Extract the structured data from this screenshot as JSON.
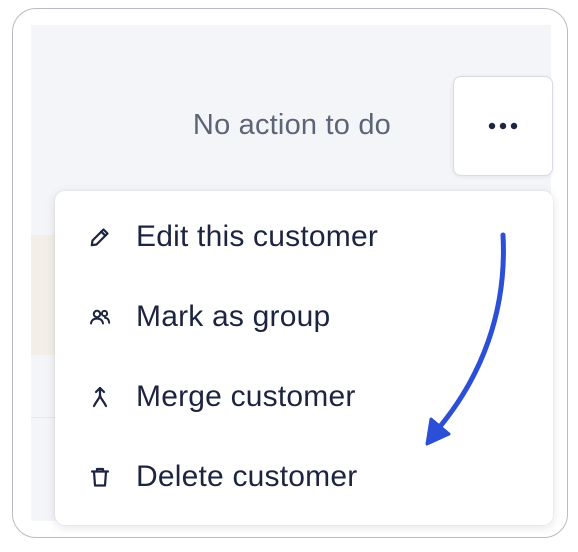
{
  "status": {
    "text": "No action to do"
  },
  "more_button": {
    "icon": "more-horizontal-icon"
  },
  "menu": {
    "items": [
      {
        "label": "Edit this customer",
        "icon": "pencil-icon"
      },
      {
        "label": "Mark as group",
        "icon": "users-icon"
      },
      {
        "label": "Merge customer",
        "icon": "merge-icon"
      },
      {
        "label": "Delete customer",
        "icon": "trash-icon"
      }
    ]
  },
  "annotation": {
    "arrow_color": "#2b4fd6",
    "icon": "curved-arrow-icon"
  },
  "colors": {
    "text_primary": "#1c2440",
    "text_muted": "#5c6478",
    "panel_bg": "#f4f5f8"
  }
}
